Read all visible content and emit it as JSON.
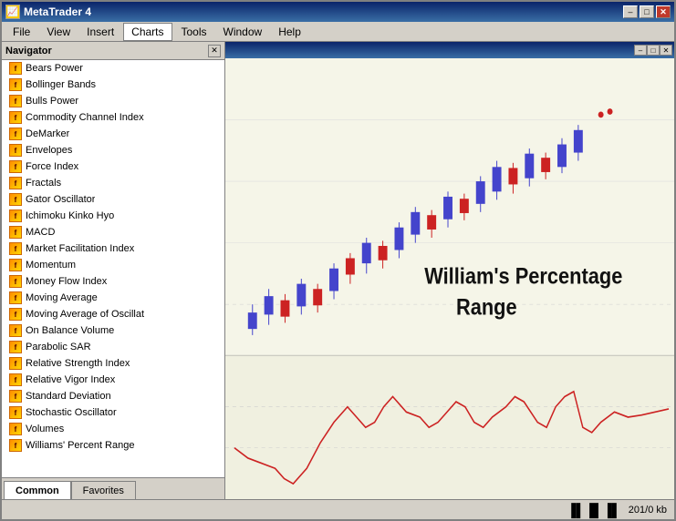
{
  "window": {
    "title": "MetaTrader 4",
    "icon": "📈"
  },
  "titleBar": {
    "minimize": "–",
    "restore": "□",
    "close": "✕"
  },
  "menu": {
    "items": [
      "File",
      "View",
      "Insert",
      "Charts",
      "Tools",
      "Window",
      "Help"
    ]
  },
  "navigator": {
    "title": "Navigator",
    "indicators": [
      "Bears Power",
      "Bollinger Bands",
      "Bulls Power",
      "Commodity Channel Index",
      "DeMarker",
      "Envelopes",
      "Force Index",
      "Fractals",
      "Gator Oscillator",
      "Ichimoku Kinko Hyo",
      "MACD",
      "Market Facilitation Index",
      "Momentum",
      "Money Flow Index",
      "Moving Average",
      "Moving Average of Oscillat",
      "On Balance Volume",
      "Parabolic SAR",
      "Relative Strength Index",
      "Relative Vigor Index",
      "Standard Deviation",
      "Stochastic Oscillator",
      "Volumes",
      "Williams' Percent Range"
    ],
    "tabs": [
      "Common",
      "Favorites"
    ]
  },
  "chart": {
    "label_line1": "William's Percentage",
    "label_line2": "Range"
  },
  "statusBar": {
    "size": "201/0 kb"
  }
}
